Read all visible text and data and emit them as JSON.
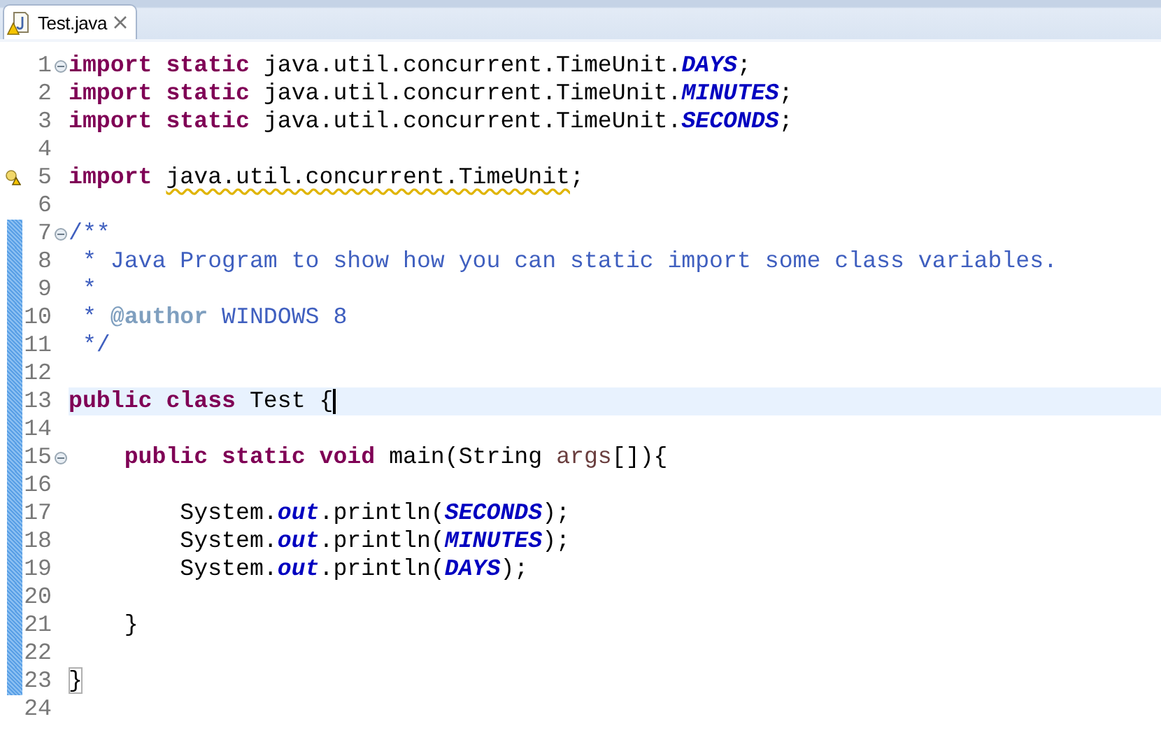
{
  "tabs": [
    {
      "label": "Test.java",
      "selected": true,
      "warning": true
    }
  ],
  "editor": {
    "lines": [
      {
        "number": "1",
        "fold": true,
        "changed": false,
        "warning": false,
        "current": false,
        "cursor": false,
        "tokens": [
          {
            "kind": "keyword",
            "text": "import "
          },
          {
            "kind": "keyword",
            "text": "static "
          },
          {
            "kind": "text",
            "text": "java.util.concurrent.TimeUnit."
          },
          {
            "kind": "constant",
            "text": "DAYS"
          },
          {
            "kind": "text",
            "text": ";"
          }
        ]
      },
      {
        "number": "2",
        "fold": false,
        "changed": false,
        "warning": false,
        "current": false,
        "cursor": false,
        "tokens": [
          {
            "kind": "keyword",
            "text": "import "
          },
          {
            "kind": "keyword",
            "text": "static "
          },
          {
            "kind": "text",
            "text": "java.util.concurrent.TimeUnit."
          },
          {
            "kind": "constant",
            "text": "MINUTES"
          },
          {
            "kind": "text",
            "text": ";"
          }
        ]
      },
      {
        "number": "3",
        "fold": false,
        "changed": false,
        "warning": false,
        "current": false,
        "cursor": false,
        "tokens": [
          {
            "kind": "keyword",
            "text": "import "
          },
          {
            "kind": "keyword",
            "text": "static "
          },
          {
            "kind": "text",
            "text": "java.util.concurrent.TimeUnit."
          },
          {
            "kind": "constant",
            "text": "SECONDS"
          },
          {
            "kind": "text",
            "text": ";"
          }
        ]
      },
      {
        "number": "4",
        "fold": false,
        "changed": false,
        "warning": false,
        "current": false,
        "cursor": false
      },
      {
        "number": "5",
        "fold": false,
        "changed": false,
        "warning": true,
        "current": false,
        "cursor": false,
        "tokens": [
          {
            "kind": "keyword",
            "text": "import "
          },
          {
            "kind": "flagged",
            "text": "java.util.concurrent.TimeUnit"
          },
          {
            "kind": "text",
            "text": ";"
          }
        ]
      },
      {
        "number": "6",
        "fold": false,
        "changed": false,
        "warning": false,
        "current": false,
        "cursor": false
      },
      {
        "number": "7",
        "fold": true,
        "changed": true,
        "warning": false,
        "current": false,
        "cursor": false,
        "tokens": [
          {
            "kind": "comment",
            "text": "/**"
          }
        ]
      },
      {
        "number": "8",
        "fold": false,
        "changed": true,
        "warning": false,
        "current": false,
        "cursor": false,
        "tokens": [
          {
            "kind": "comment",
            "text": " * Java Program to show how you can static import some class variables."
          }
        ]
      },
      {
        "number": "9",
        "fold": false,
        "changed": true,
        "warning": false,
        "current": false,
        "cursor": false,
        "tokens": [
          {
            "kind": "comment",
            "text": " *"
          }
        ]
      },
      {
        "number": "10",
        "fold": false,
        "changed": true,
        "warning": false,
        "current": false,
        "cursor": false,
        "tokens": [
          {
            "kind": "comment",
            "text": " * "
          },
          {
            "kind": "doc_tag",
            "text": "@author"
          },
          {
            "kind": "comment",
            "text": " WINDOWS 8"
          }
        ]
      },
      {
        "number": "11",
        "fold": false,
        "changed": true,
        "warning": false,
        "current": false,
        "cursor": false,
        "tokens": [
          {
            "kind": "comment",
            "text": " */"
          }
        ]
      },
      {
        "number": "12",
        "fold": false,
        "changed": true,
        "warning": false,
        "current": false,
        "cursor": false
      },
      {
        "number": "13",
        "fold": false,
        "changed": true,
        "warning": false,
        "current": true,
        "cursor": true,
        "tokens": [
          {
            "kind": "keyword",
            "text": "public "
          },
          {
            "kind": "keyword",
            "text": "class "
          },
          {
            "kind": "text",
            "text": "Test {"
          }
        ]
      },
      {
        "number": "14",
        "fold": false,
        "changed": true,
        "warning": false,
        "current": false,
        "cursor": false
      },
      {
        "number": "15",
        "fold": true,
        "changed": true,
        "warning": false,
        "current": false,
        "cursor": false,
        "tokens": [
          {
            "kind": "keyword",
            "text": "    public "
          },
          {
            "kind": "keyword",
            "text": "static "
          },
          {
            "kind": "keyword",
            "text": "void "
          },
          {
            "kind": "text",
            "text": "main(String "
          },
          {
            "kind": "param",
            "text": "args"
          },
          {
            "kind": "text",
            "text": "[]){"
          }
        ]
      },
      {
        "number": "16",
        "fold": false,
        "changed": true,
        "warning": false,
        "current": false,
        "cursor": false
      },
      {
        "number": "17",
        "fold": false,
        "changed": true,
        "warning": false,
        "current": false,
        "cursor": false,
        "tokens": [
          {
            "kind": "text",
            "text": "        System."
          },
          {
            "kind": "constant",
            "text": "out"
          },
          {
            "kind": "text",
            "text": ".println("
          },
          {
            "kind": "constant",
            "text": "SECONDS"
          },
          {
            "kind": "text",
            "text": ");"
          }
        ]
      },
      {
        "number": "18",
        "fold": false,
        "changed": true,
        "warning": false,
        "current": false,
        "cursor": false,
        "tokens": [
          {
            "kind": "text",
            "text": "        System."
          },
          {
            "kind": "constant",
            "text": "out"
          },
          {
            "kind": "text",
            "text": ".println("
          },
          {
            "kind": "constant",
            "text": "MINUTES"
          },
          {
            "kind": "text",
            "text": ");"
          }
        ]
      },
      {
        "number": "19",
        "fold": false,
        "changed": true,
        "warning": false,
        "current": false,
        "cursor": false,
        "tokens": [
          {
            "kind": "text",
            "text": "        System."
          },
          {
            "kind": "constant",
            "text": "out"
          },
          {
            "kind": "text",
            "text": ".println("
          },
          {
            "kind": "constant",
            "text": "DAYS"
          },
          {
            "kind": "text",
            "text": ");"
          }
        ]
      },
      {
        "number": "20",
        "fold": false,
        "changed": true,
        "warning": false,
        "current": false,
        "cursor": false
      },
      {
        "number": "21",
        "fold": false,
        "changed": true,
        "warning": false,
        "current": false,
        "cursor": false,
        "tokens": [
          {
            "kind": "text",
            "text": "    }"
          }
        ]
      },
      {
        "number": "22",
        "fold": false,
        "changed": true,
        "warning": false,
        "current": false,
        "cursor": false
      },
      {
        "number": "23",
        "fold": false,
        "changed": true,
        "warning": false,
        "current": false,
        "cursor": false,
        "tokens": [
          {
            "kind": "matched_bracket",
            "text": "}"
          }
        ]
      },
      {
        "number": "24",
        "fold": false,
        "changed": false,
        "warning": false,
        "current": false,
        "cursor": false
      }
    ]
  }
}
